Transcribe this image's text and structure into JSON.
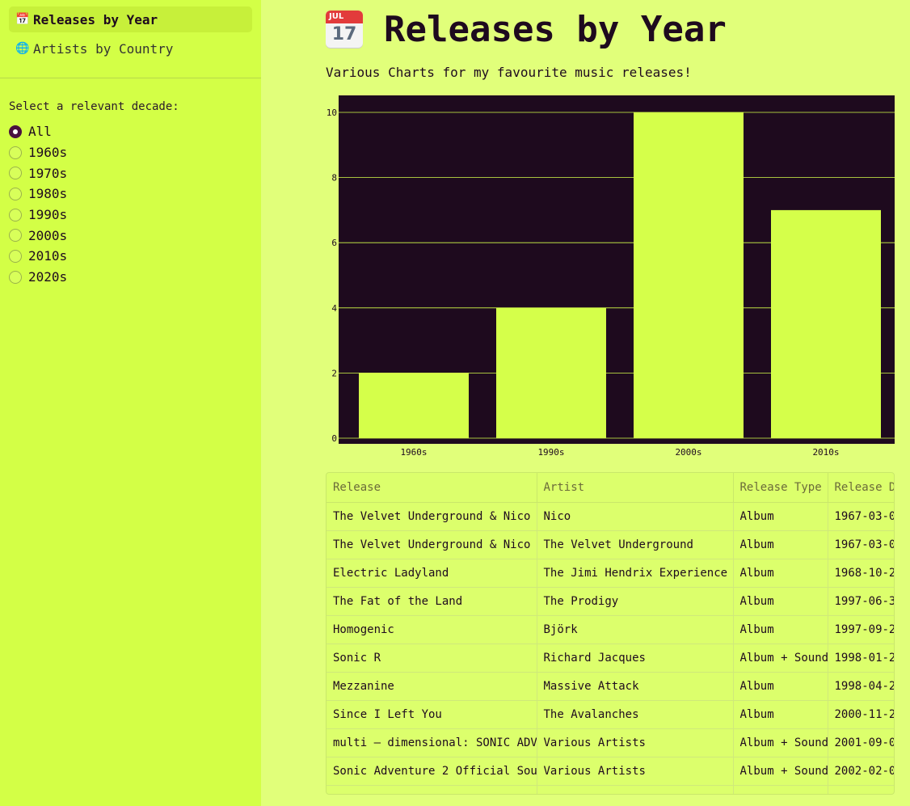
{
  "nav": {
    "items": [
      {
        "icon": "📅",
        "label": "Releases by Year",
        "active": true
      },
      {
        "icon": "🌐",
        "label": "Artists by Country",
        "active": false
      }
    ]
  },
  "decades": {
    "label": "Select a relevant decade:",
    "options": [
      "All",
      "1960s",
      "1970s",
      "1980s",
      "1990s",
      "2000s",
      "2010s",
      "2020s"
    ],
    "selected": "All"
  },
  "page": {
    "title_icon": "calendar-icon",
    "cal_month": "JUL",
    "cal_day": "17",
    "title": "Releases by Year",
    "subtitle": "Various Charts for my favourite music releases!"
  },
  "chart_data": {
    "type": "bar",
    "categories": [
      "1960s",
      "1990s",
      "2000s",
      "2010s"
    ],
    "values": [
      2,
      4,
      10,
      7
    ],
    "ylim": [
      0,
      10
    ],
    "yticks": [
      0,
      2,
      4,
      6,
      8,
      10
    ],
    "grid": true,
    "bar_color": "#d5ff4a",
    "background": "#1e0a1e"
  },
  "table": {
    "columns": [
      "Release",
      "Artist",
      "Release Type",
      "Release Date"
    ],
    "rows": [
      [
        "The Velvet Underground & Nico",
        "Nico",
        "Album",
        "1967-03-0"
      ],
      [
        "The Velvet Underground & Nico",
        "The Velvet Underground",
        "Album",
        "1967-03-0"
      ],
      [
        "Electric Ladyland",
        "The Jimi Hendrix Experience",
        "Album",
        "1968-10-2"
      ],
      [
        "The Fat of the Land",
        "The Prodigy",
        "Album",
        "1997-06-3"
      ],
      [
        "Homogenic",
        "Björk",
        "Album",
        "1997-09-2"
      ],
      [
        "Sonic R",
        "Richard Jacques",
        "Album + Sound",
        "1998-01-2"
      ],
      [
        "Mezzanine",
        "Massive Attack",
        "Album",
        "1998-04-2"
      ],
      [
        "Since I Left You",
        "The Avalanches",
        "Album",
        "2000-11-2"
      ],
      [
        "multi – dimensional: SONIC ADV",
        "Various Artists",
        "Album + Sound",
        "2001-09-0"
      ],
      [
        "Sonic Adventure 2 Official Sou",
        "Various Artists",
        "Album + Sound",
        "2002-02-0"
      ],
      [
        "",
        "",
        "",
        ""
      ]
    ]
  }
}
